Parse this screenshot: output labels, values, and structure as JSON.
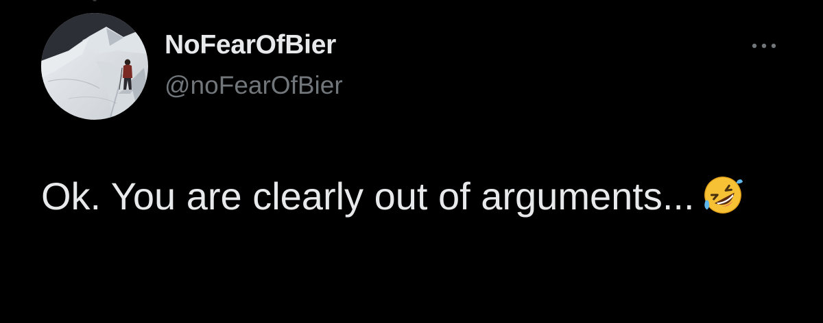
{
  "tweet": {
    "author": {
      "display_name": "NoFearOfBier",
      "handle": "@noFearOfBier",
      "avatar_icon": "snow-mountain-hiker-avatar"
    },
    "more_icon": "ellipsis-icon",
    "text": "Ok. You are clearly out of arguments...",
    "emoji": "rolling-on-the-floor-laughing-emoji"
  },
  "colors": {
    "background": "#000000",
    "primary_text": "#e7e9ea",
    "secondary_text": "#71767b"
  }
}
